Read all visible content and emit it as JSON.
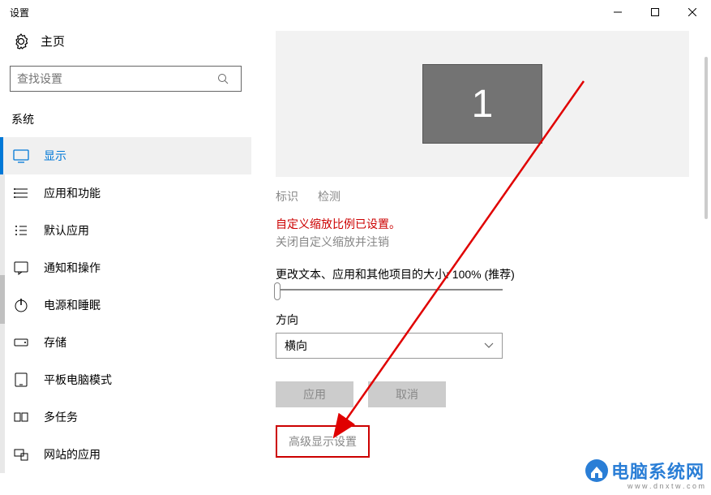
{
  "titlebar": {
    "title": "设置"
  },
  "sidebar": {
    "home": "主页",
    "searchPlaceholder": "查找设置",
    "category": "系统",
    "items": [
      {
        "label": "显示",
        "active": true
      },
      {
        "label": "应用和功能"
      },
      {
        "label": "默认应用"
      },
      {
        "label": "通知和操作"
      },
      {
        "label": "电源和睡眠"
      },
      {
        "label": "存储"
      },
      {
        "label": "平板电脑模式"
      },
      {
        "label": "多任务"
      },
      {
        "label": "网站的应用"
      }
    ]
  },
  "content": {
    "monitorNumber": "1",
    "identify": "标识",
    "detect": "检测",
    "warning": "自定义缩放比例已设置。",
    "signout": "关闭自定义缩放并注销",
    "scaleLabel": "更改文本、应用和其他项目的大小: 100% (推荐)",
    "orientationLabel": "方向",
    "orientationValue": "横向",
    "applyBtn": "应用",
    "cancelBtn": "取消",
    "advancedLink": "高级显示设置"
  },
  "watermark": {
    "text": "电脑系统网",
    "url": "w w w . d n x t w . c o m"
  }
}
